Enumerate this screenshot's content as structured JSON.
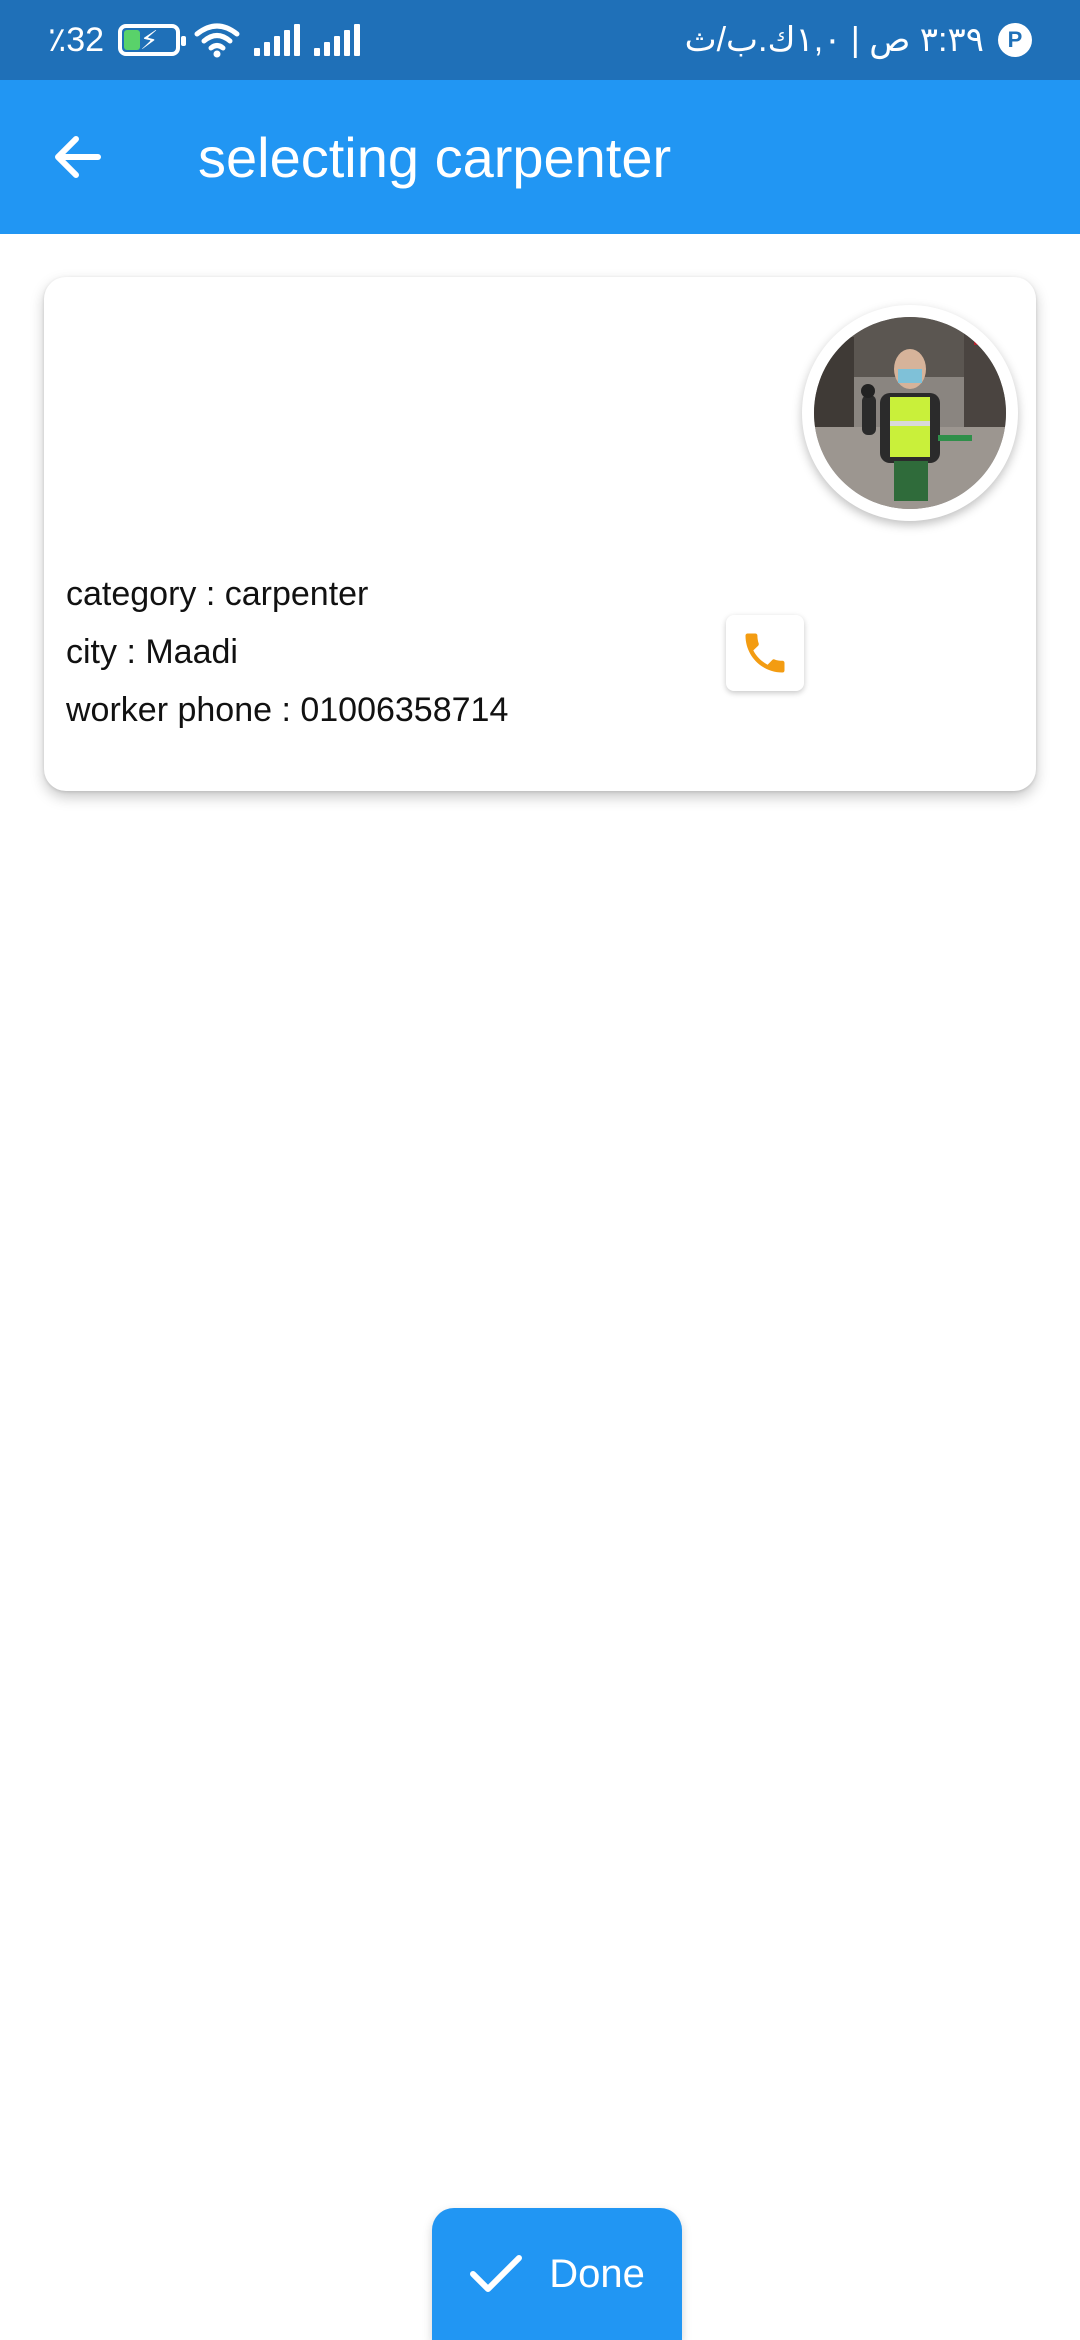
{
  "status_bar": {
    "battery_percent": "٪32",
    "time_text": "٣:٣٩ ص | ١,٠ك.ب/ث",
    "icons": [
      "battery-charging-icon",
      "wifi-icon",
      "signal-icon",
      "signal-icon",
      "app-indicator-icon"
    ]
  },
  "app_bar": {
    "title": "selecting carpenter",
    "back_icon": "arrow-back-icon",
    "color": "#2196f3"
  },
  "worker": {
    "category": "category : carpenter",
    "city": "city : Maadi",
    "phone": "worker phone : 01006358714",
    "call_icon": "phone-icon",
    "call_icon_color": "#f39c12"
  },
  "done_button": {
    "label": "Done",
    "icon": "check-icon"
  }
}
